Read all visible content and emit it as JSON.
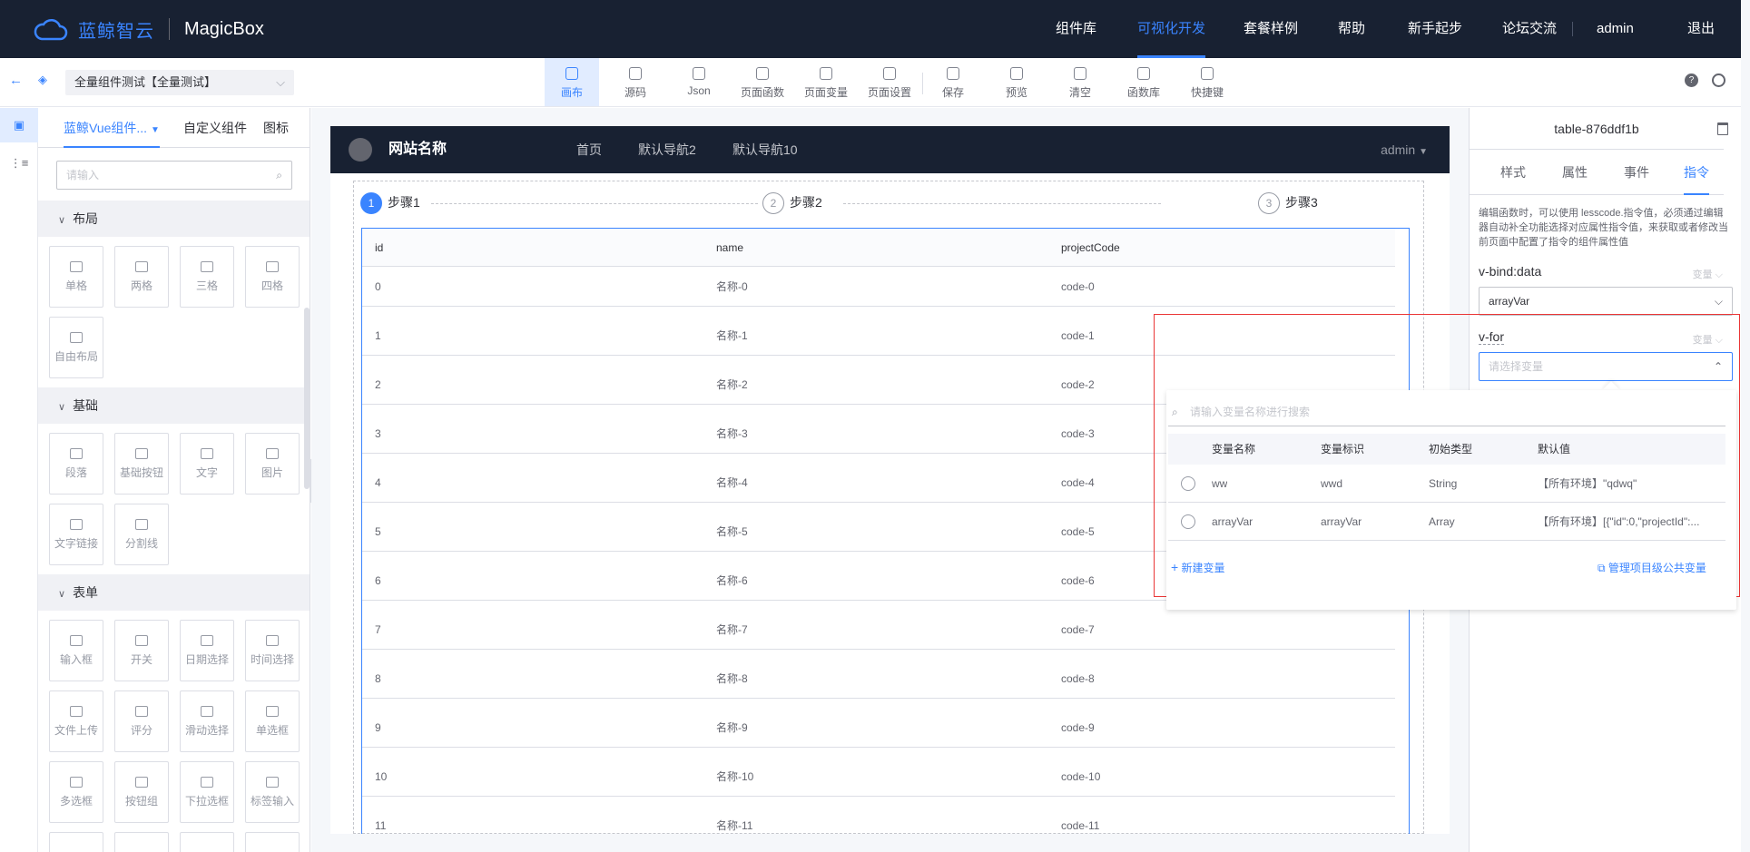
{
  "topnav": {
    "brand_text": "蓝鲸智云",
    "product": "MagicBox",
    "items": [
      "组件库",
      "可视化开发",
      "套餐样例",
      "帮助",
      "新手起步",
      "论坛交流",
      "admin",
      "退出"
    ],
    "active": "可视化开发"
  },
  "toolbar": {
    "project_select": "全量组件测试【全量测试】",
    "buttons": [
      "画布",
      "源码",
      "Json",
      "页面函数",
      "页面变量",
      "页面设置",
      "保存",
      "预览",
      "清空",
      "函数库",
      "快捷键"
    ],
    "active": "画布"
  },
  "leftpanel": {
    "tabs": [
      "蓝鲸Vue组件...",
      "自定义组件",
      "图标"
    ],
    "search_placeholder": "请输入",
    "groups": [
      {
        "title": "布局",
        "items": [
          "单格",
          "两格",
          "三格",
          "四格",
          "自由布局"
        ]
      },
      {
        "title": "基础",
        "items": [
          "段落",
          "基础按钮",
          "文字",
          "图片",
          "文字链接",
          "分割线"
        ]
      },
      {
        "title": "表单",
        "items": [
          "输入框",
          "开关",
          "日期选择",
          "时间选择",
          "文件上传",
          "评分",
          "滑动选择",
          "单选框",
          "多选框",
          "按钮组",
          "下拉选框",
          "标签输入"
        ]
      }
    ]
  },
  "canvas": {
    "site_title": "网站名称",
    "nav": [
      "首页",
      "默认导航2",
      "默认导航10"
    ],
    "user": "admin",
    "steps": [
      {
        "num": "1",
        "label": "步骤1"
      },
      {
        "num": "2",
        "label": "步骤2"
      },
      {
        "num": "3",
        "label": "步骤3"
      }
    ],
    "table": {
      "columns": [
        "id",
        "name",
        "projectCode"
      ],
      "rows": [
        [
          "0",
          "名称-0",
          "code-0"
        ],
        [
          "1",
          "名称-1",
          "code-1"
        ],
        [
          "2",
          "名称-2",
          "code-2"
        ],
        [
          "3",
          "名称-3",
          "code-3"
        ],
        [
          "4",
          "名称-4",
          "code-4"
        ],
        [
          "5",
          "名称-5",
          "code-5"
        ],
        [
          "6",
          "名称-6",
          "code-6"
        ],
        [
          "7",
          "名称-7",
          "code-7"
        ],
        [
          "8",
          "名称-8",
          "code-8"
        ],
        [
          "9",
          "名称-9",
          "code-9"
        ],
        [
          "10",
          "名称-10",
          "code-10"
        ],
        [
          "11",
          "名称-11",
          "code-11"
        ]
      ]
    }
  },
  "rightpanel": {
    "title": "table-876ddf1b",
    "tabs": [
      "样式",
      "属性",
      "事件",
      "指令"
    ],
    "active_tab": "指令",
    "desc": "编辑函数时，可以使用 lesscode.指令值，必须通过编辑器自动补全功能选择对应属性指令值，来获取或者修改当前页面中配置了指令的组件属性值",
    "vbind_label": "v-bind:data",
    "vbind_hint": "变量",
    "vbind_value": "arrayVar",
    "vfor_label": "v-for",
    "vfor_hint": "变量",
    "vfor_placeholder": "请选择变量"
  },
  "dropdown": {
    "search_placeholder": "请输入变量名称进行搜索",
    "columns": [
      "变量名称",
      "变量标识",
      "初始类型",
      "默认值"
    ],
    "rows": [
      [
        "ww",
        "wwd",
        "String",
        "【所有环境】\"qdwq\""
      ],
      [
        "arrayVar",
        "arrayVar",
        "Array",
        "【所有环境】[{\"id\":0,\"projectId\":..."
      ]
    ],
    "new_var": "新建变量",
    "manage": "管理项目级公共变量"
  }
}
